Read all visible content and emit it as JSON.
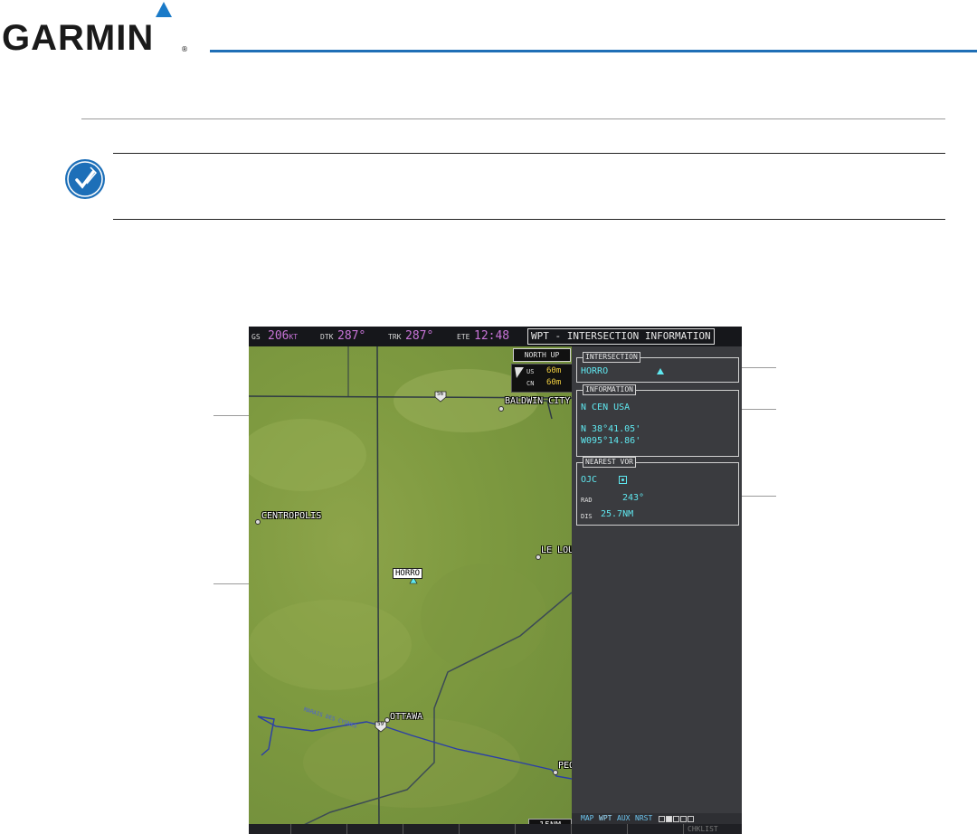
{
  "brand": {
    "name": "GARMIN",
    "reg": "®"
  },
  "colors": {
    "brand_blue": "#1f6fb6",
    "magenta": "#c874d8",
    "cyan": "#5fe8f0",
    "yellow": "#f2d040"
  },
  "note": {
    "icon": "note-check-icon"
  },
  "navbar": {
    "gs_label": "GS",
    "gs_value": "206",
    "gs_unit": "KT",
    "dtk_label": "DTK",
    "dtk_value": "287°",
    "trk_label": "TRK",
    "trk_value": "287°",
    "ete_label": "ETE",
    "ete_value": "12:48"
  },
  "page_title": "WPT - INTERSECTION INFORMATION",
  "map": {
    "orientation": "NORTH UP",
    "alt_rows": [
      {
        "label": "US",
        "value": "60m"
      },
      {
        "label": "CN",
        "value": "60m"
      }
    ],
    "labels": {
      "baldwin": "BALDWIN CITY",
      "centropolis": "CENTROPOLIS",
      "leloup": "LE LOU",
      "ottawa": "OTTAWA",
      "peoria": "PEO",
      "waypoint": "HORRO",
      "river": "MARAIS DES CYGNES",
      "hwy1": "56",
      "hwy2": "59"
    },
    "range": "15NM"
  },
  "intersection": {
    "title": "INTERSECTION",
    "ident": "HORRO"
  },
  "information": {
    "title": "INFORMATION",
    "region": "N CEN USA",
    "lat": "N 38°41.05'",
    "lon": "W095°14.86'"
  },
  "nearest_vor": {
    "title": "NEAREST VOR",
    "ident": "OJC",
    "rad_label": "RAD",
    "rad_value": "243°",
    "dis_label": "DIS",
    "dis_value": "25.7NM"
  },
  "page_group": {
    "items": [
      "MAP",
      "WPT",
      "AUX",
      "NRST"
    ],
    "active": "WPT"
  },
  "softkeys": {
    "last_label": "CHKLIST"
  }
}
